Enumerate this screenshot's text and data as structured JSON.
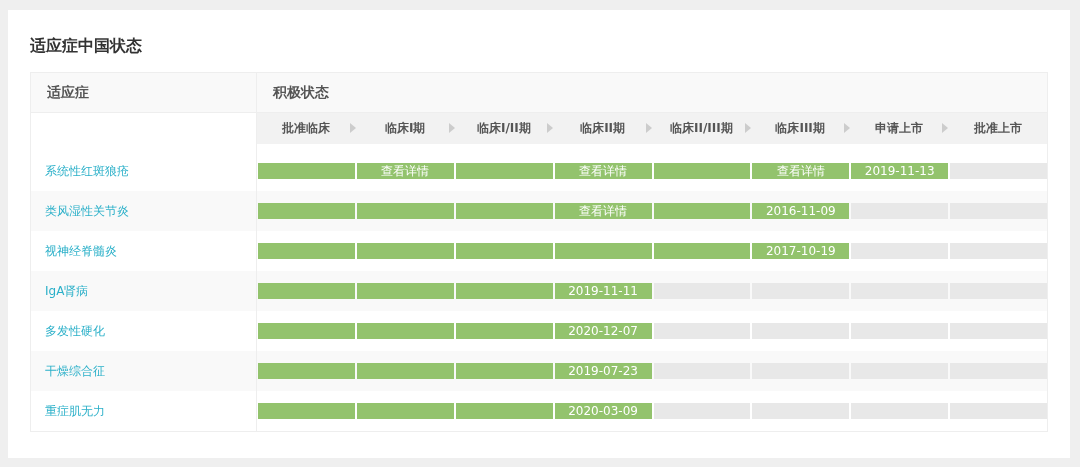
{
  "title": "适应症中国状态",
  "table": {
    "columns": [
      "适应症",
      "积极状态"
    ],
    "phases": [
      "批准临床",
      "临床I期",
      "临床I/II期",
      "临床II期",
      "临床II/III期",
      "临床III期",
      "申请上市",
      "批准上市"
    ],
    "rows": [
      {
        "indication": "系统性红斑狼疮",
        "cells": [
          {
            "filled": true
          },
          {
            "filled": true,
            "text": "查看详情"
          },
          {
            "filled": true
          },
          {
            "filled": true,
            "text": "查看详情"
          },
          {
            "filled": true
          },
          {
            "filled": true,
            "text": "查看详情"
          },
          {
            "filled": true,
            "text": "2019-11-13"
          },
          {
            "filled": false
          }
        ]
      },
      {
        "indication": "类风湿性关节炎",
        "cells": [
          {
            "filled": true
          },
          {
            "filled": true
          },
          {
            "filled": true
          },
          {
            "filled": true,
            "text": "查看详情"
          },
          {
            "filled": true
          },
          {
            "filled": true,
            "text": "2016-11-09"
          },
          {
            "filled": false
          },
          {
            "filled": false
          }
        ]
      },
      {
        "indication": "视神经脊髓炎",
        "cells": [
          {
            "filled": true
          },
          {
            "filled": true
          },
          {
            "filled": true
          },
          {
            "filled": true
          },
          {
            "filled": true
          },
          {
            "filled": true,
            "text": "2017-10-19"
          },
          {
            "filled": false
          },
          {
            "filled": false
          }
        ]
      },
      {
        "indication": "IgA肾病",
        "cells": [
          {
            "filled": true
          },
          {
            "filled": true
          },
          {
            "filled": true
          },
          {
            "filled": true,
            "text": "2019-11-11"
          },
          {
            "filled": false
          },
          {
            "filled": false
          },
          {
            "filled": false
          },
          {
            "filled": false
          }
        ]
      },
      {
        "indication": "多发性硬化",
        "cells": [
          {
            "filled": true
          },
          {
            "filled": true
          },
          {
            "filled": true
          },
          {
            "filled": true,
            "text": "2020-12-07"
          },
          {
            "filled": false
          },
          {
            "filled": false
          },
          {
            "filled": false
          },
          {
            "filled": false
          }
        ]
      },
      {
        "indication": "干燥综合征",
        "cells": [
          {
            "filled": true
          },
          {
            "filled": true
          },
          {
            "filled": true
          },
          {
            "filled": true,
            "text": "2019-07-23"
          },
          {
            "filled": false
          },
          {
            "filled": false
          },
          {
            "filled": false
          },
          {
            "filled": false
          }
        ]
      },
      {
        "indication": "重症肌无力",
        "cells": [
          {
            "filled": true
          },
          {
            "filled": true
          },
          {
            "filled": true
          },
          {
            "filled": true,
            "text": "2020-03-09"
          },
          {
            "filled": false
          },
          {
            "filled": false
          },
          {
            "filled": false
          },
          {
            "filled": false
          }
        ]
      }
    ]
  }
}
